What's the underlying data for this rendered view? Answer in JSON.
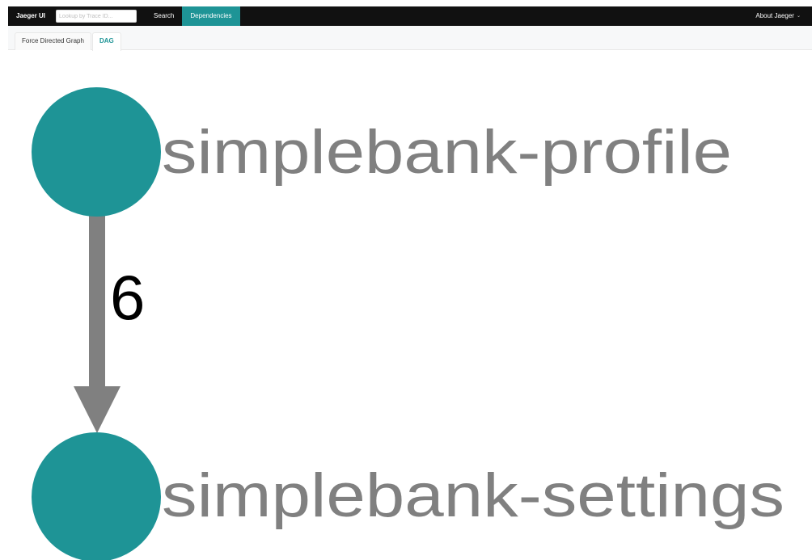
{
  "topnav": {
    "brand": "Jaeger UI",
    "lookup_placeholder": "Lookup by Trace ID...",
    "links": [
      "Search",
      "Dependencies"
    ],
    "active_link": "Dependencies",
    "about": "About Jaeger"
  },
  "tabs": [
    {
      "label": "Force Directed Graph",
      "active": false
    },
    {
      "label": "DAG",
      "active": true
    }
  ],
  "graph": {
    "nodes": [
      {
        "label": "simplebank-profile"
      },
      {
        "label": "simplebank-settings"
      }
    ],
    "edges": [
      {
        "from": "simplebank-profile",
        "to": "simplebank-settings",
        "label": "6"
      }
    ]
  },
  "colors": {
    "nav_bg": "#111111",
    "accent": "#1e9496",
    "node": "#1e9496",
    "edge": "#808080",
    "node_label": "#808080",
    "edge_label": "#000000"
  },
  "icons": {
    "about_dropdown": "chevron-down-icon"
  }
}
